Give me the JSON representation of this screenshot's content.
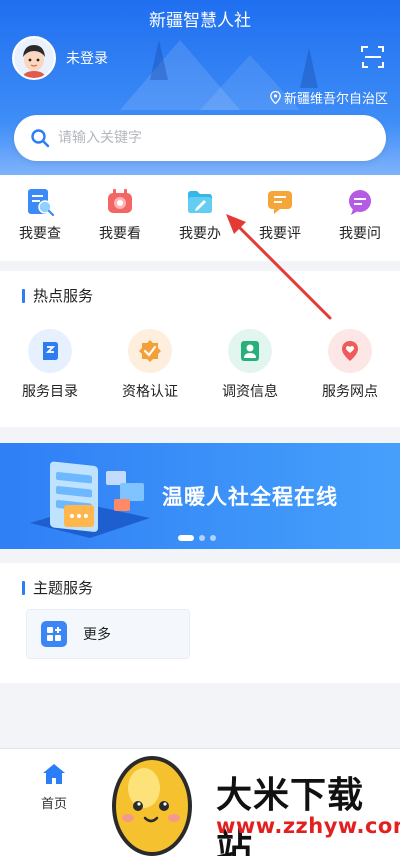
{
  "header": {
    "title": "新疆智慧人社",
    "login_status": "未登录",
    "region": "新疆维吾尔自治区",
    "search_placeholder": "请输入关键字"
  },
  "quick_nav": [
    {
      "label": "我要查",
      "icon": "search-doc-icon",
      "color": "#3b8af6"
    },
    {
      "label": "我要看",
      "icon": "tv-icon",
      "color": "#f26666"
    },
    {
      "label": "我要办",
      "icon": "folder-pen-icon",
      "color": "#37b6e8"
    },
    {
      "label": "我要评",
      "icon": "comment-icon",
      "color": "#f5a63a"
    },
    {
      "label": "我要问",
      "icon": "chat-question-icon",
      "color": "#b55be6"
    }
  ],
  "hot_services": {
    "title": "热点服务",
    "items": [
      {
        "label": "服务目录",
        "icon": "catalog-icon",
        "bg": "#e7f0fe",
        "color": "#2f7cf0"
      },
      {
        "label": "资格认证",
        "icon": "badge-check-icon",
        "bg": "#fdeedd",
        "color": "#f4a03a"
      },
      {
        "label": "调资信息",
        "icon": "user-info-icon",
        "bg": "#e2f5ee",
        "color": "#27b07a"
      },
      {
        "label": "服务网点",
        "icon": "location-heart-icon",
        "bg": "#fde6e6",
        "color": "#ef5b5b"
      }
    ]
  },
  "banner": {
    "text": "温暖人社全程在线"
  },
  "theme_services": {
    "title": "主题服务",
    "more_label": "更多"
  },
  "tabbar": {
    "home_label": "首页"
  },
  "watermark": {
    "brand": "大米下载站",
    "url": "www.zzhyw.com"
  },
  "colors": {
    "primary": "#2b7ef7",
    "arrow": "#e53935"
  }
}
